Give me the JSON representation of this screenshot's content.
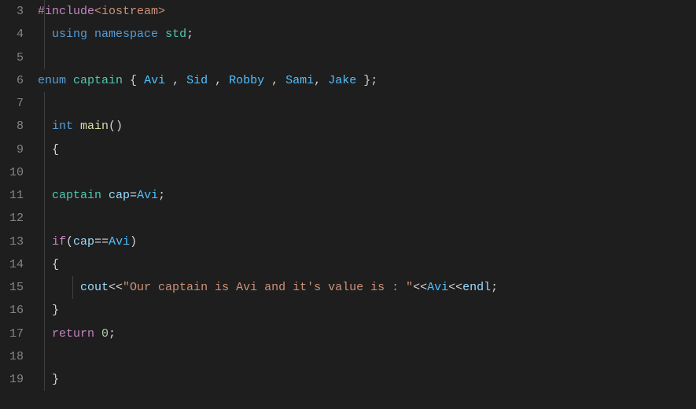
{
  "editor": {
    "startLine": 3,
    "lineNumbers": [
      "3",
      "4",
      "5",
      "6",
      "7",
      "8",
      "9",
      "10",
      "11",
      "12",
      "13",
      "14",
      "15",
      "16",
      "17",
      "18",
      "19"
    ],
    "lines": {
      "l3": {
        "preproc": "#include",
        "header": "<iostream>"
      },
      "l4": {
        "using": "using",
        "namespace": "namespace",
        "std": "std",
        "semi": ";"
      },
      "l5": {},
      "l6": {
        "enum": "enum",
        "captain": "captain",
        "lbrace": " { ",
        "avi": "Avi",
        "c1": " , ",
        "sid": "Sid",
        "c2": " , ",
        "robby": "Robby",
        "c3": " , ",
        "sami": "Sami",
        "c4": ", ",
        "jake": "Jake",
        "rbrace": " };"
      },
      "l7": {},
      "l8": {
        "int": "int",
        "main": " main",
        "parens": "()"
      },
      "l9": {
        "lbrace": "{"
      },
      "l10": {},
      "l11": {
        "captain": "captain",
        "cap": " cap",
        "eq": "=",
        "avi": "Avi",
        "semi": ";"
      },
      "l12": {},
      "l13": {
        "if": "if",
        "lparen": "(",
        "cap": "cap",
        "eqeq": "==",
        "avi": "Avi",
        "rparen": ")"
      },
      "l14": {
        "lbrace": "{"
      },
      "l15": {
        "cout": "cout",
        "lshift1": "<<",
        "str": "\"Our captain is Avi and it's value is : \"",
        "lshift2": "<<",
        "avi": "Avi",
        "lshift3": "<<",
        "endl": "endl",
        "semi": ";"
      },
      "l16": {
        "rbrace": "}"
      },
      "l17": {
        "return": "return",
        "zero": " 0",
        "semi": ";"
      },
      "l18": {},
      "l19": {
        "rbrace": "}"
      }
    }
  }
}
